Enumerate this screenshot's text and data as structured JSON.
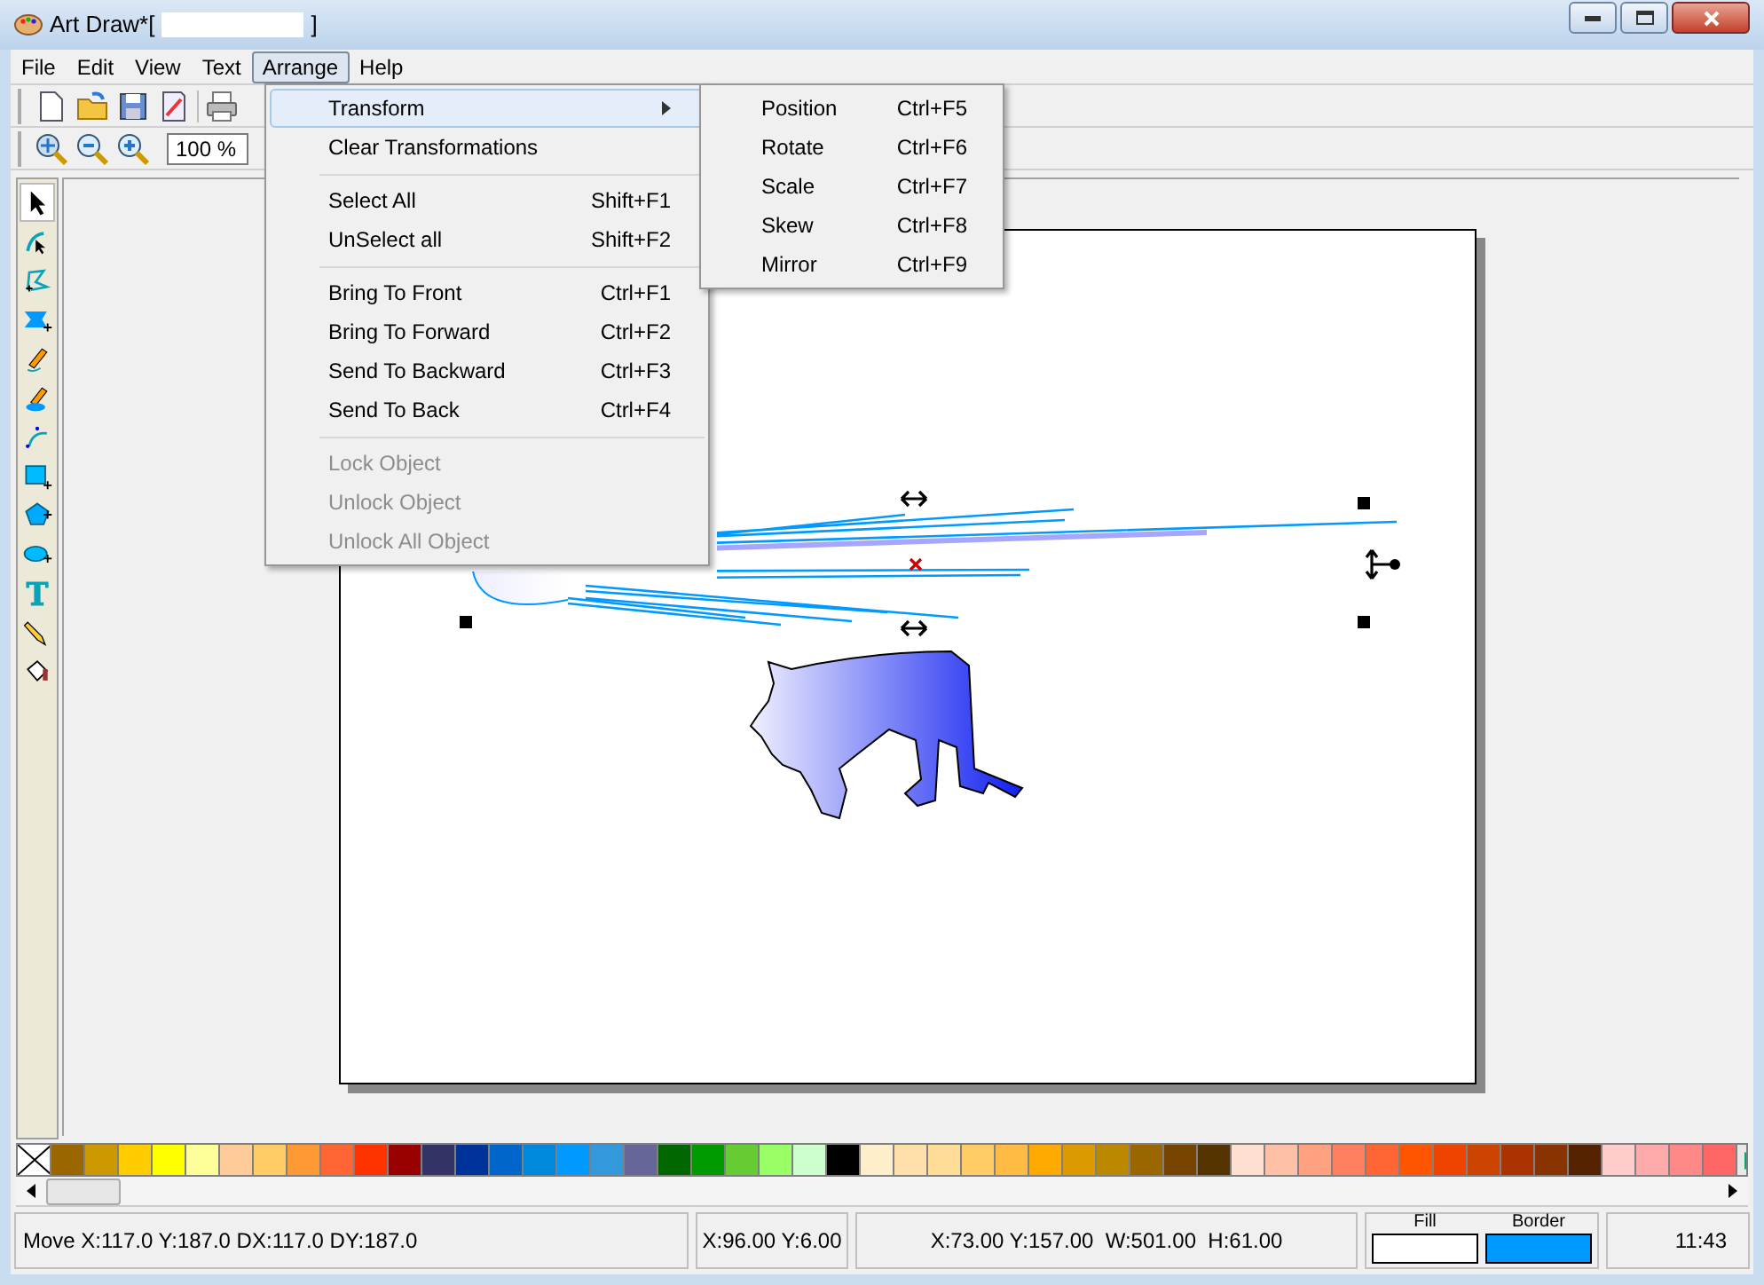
{
  "window": {
    "title": "Art Draw*[",
    "title_end": "]"
  },
  "menu_bar": [
    {
      "label": "File",
      "selected": false
    },
    {
      "label": "Edit",
      "selected": false
    },
    {
      "label": "View",
      "selected": false
    },
    {
      "label": "Text",
      "selected": false
    },
    {
      "label": "Arrange",
      "selected": true
    },
    {
      "label": "Help",
      "selected": false
    }
  ],
  "zoom": {
    "value": "100 %"
  },
  "arrange_menu": [
    {
      "kind": "item",
      "label": "Transform",
      "submenu": true,
      "selected": true,
      "disabled": false
    },
    {
      "kind": "item",
      "label": "Clear Transformations",
      "submenu": false,
      "selected": false,
      "disabled": false
    },
    {
      "kind": "separator"
    },
    {
      "kind": "item",
      "label": "Select All",
      "shortcut": "Shift+F1",
      "submenu": false,
      "selected": false,
      "disabled": false
    },
    {
      "kind": "item",
      "label": "UnSelect all",
      "shortcut": "Shift+F2",
      "submenu": false,
      "selected": false,
      "disabled": false
    },
    {
      "kind": "separator"
    },
    {
      "kind": "item",
      "label": "Bring To Front",
      "shortcut": "Ctrl+F1",
      "submenu": false,
      "selected": false,
      "disabled": false
    },
    {
      "kind": "item",
      "label": "Bring To Forward",
      "shortcut": "Ctrl+F2",
      "submenu": false,
      "selected": false,
      "disabled": false
    },
    {
      "kind": "item",
      "label": "Send To Backward",
      "shortcut": "Ctrl+F3",
      "submenu": false,
      "selected": false,
      "disabled": false
    },
    {
      "kind": "item",
      "label": "Send To Back",
      "shortcut": "Ctrl+F4",
      "submenu": false,
      "selected": false,
      "disabled": false
    },
    {
      "kind": "separator"
    },
    {
      "kind": "item",
      "label": "Lock Object",
      "submenu": false,
      "selected": false,
      "disabled": true
    },
    {
      "kind": "item",
      "label": "Unlock Object",
      "submenu": false,
      "selected": false,
      "disabled": true
    },
    {
      "kind": "item",
      "label": "Unlock All Object",
      "submenu": false,
      "selected": false,
      "disabled": true
    }
  ],
  "transform_submenu": [
    {
      "label": "Position",
      "shortcut": "Ctrl+F5"
    },
    {
      "label": "Rotate",
      "shortcut": "Ctrl+F6"
    },
    {
      "label": "Scale",
      "shortcut": "Ctrl+F7"
    },
    {
      "label": "Skew",
      "shortcut": "Ctrl+F8"
    },
    {
      "label": "Mirror",
      "shortcut": "Ctrl+F9"
    }
  ],
  "tools": [
    {
      "kind": "select",
      "selected": true
    },
    {
      "kind": "node",
      "selected": false
    },
    {
      "kind": "polyline",
      "selected": false
    },
    {
      "kind": "polygon",
      "selected": false
    },
    {
      "kind": "pencil",
      "selected": false
    },
    {
      "kind": "brush",
      "selected": false
    },
    {
      "kind": "curve",
      "selected": false
    },
    {
      "kind": "rectangle",
      "selected": false
    },
    {
      "kind": "pentagon",
      "selected": false
    },
    {
      "kind": "ellipse",
      "selected": false
    },
    {
      "kind": "text",
      "selected": false
    },
    {
      "kind": "pen",
      "selected": false
    },
    {
      "kind": "fill",
      "selected": false
    }
  ],
  "palette": [
    {
      "color": "#996600"
    },
    {
      "color": "#cc9900"
    },
    {
      "color": "#ffcc00"
    },
    {
      "color": "#ffff00"
    },
    {
      "color": "#ffff99"
    },
    {
      "color": "#ffcc99"
    },
    {
      "color": "#ffcc66"
    },
    {
      "color": "#ff9933"
    },
    {
      "color": "#ff6633"
    },
    {
      "color": "#ff3300"
    },
    {
      "color": "#990000"
    },
    {
      "color": "#333366"
    },
    {
      "color": "#003399"
    },
    {
      "color": "#0066cc"
    },
    {
      "color": "#0088dd"
    },
    {
      "color": "#0099ff"
    },
    {
      "color": "#3399dd"
    },
    {
      "color": "#666699"
    },
    {
      "color": "#006600"
    },
    {
      "color": "#009900"
    },
    {
      "color": "#66cc33"
    },
    {
      "color": "#99ff66"
    },
    {
      "color": "#ccffcc"
    },
    {
      "color": "#000000"
    },
    {
      "color": "#ffeecc"
    },
    {
      "color": "#ffe0aa"
    },
    {
      "color": "#ffdd99"
    },
    {
      "color": "#ffcc66"
    },
    {
      "color": "#ffbb44"
    },
    {
      "color": "#ffaa00"
    },
    {
      "color": "#dd9900"
    },
    {
      "color": "#bb8800"
    },
    {
      "color": "#996600"
    },
    {
      "color": "#774400"
    },
    {
      "color": "#553300"
    },
    {
      "color": "#ffe0d0"
    },
    {
      "color": "#ffc0a8"
    },
    {
      "color": "#ffa080"
    },
    {
      "color": "#ff8060"
    },
    {
      "color": "#ff6633"
    },
    {
      "color": "#ff5500"
    },
    {
      "color": "#ee4400"
    },
    {
      "color": "#cc4400"
    },
    {
      "color": "#aa3300"
    },
    {
      "color": "#883300"
    },
    {
      "color": "#552200"
    },
    {
      "color": "#ffcccc"
    },
    {
      "color": "#ffaaaa"
    },
    {
      "color": "#ff8888"
    },
    {
      "color": "#ff6666"
    }
  ],
  "status_bar": {
    "message": "Move X:117.0 Y:187.0 DX:117.0 DY:187.0",
    "cursor": "X:96.00 Y:6.00",
    "selection": "X:73.00 Y:157.00  W:501.00  H:61.00",
    "swatches": [
      {
        "label": "Fill",
        "color": "#ffffff"
      },
      {
        "label": "Border",
        "color": "#0099ff"
      }
    ],
    "time": "11:43"
  }
}
